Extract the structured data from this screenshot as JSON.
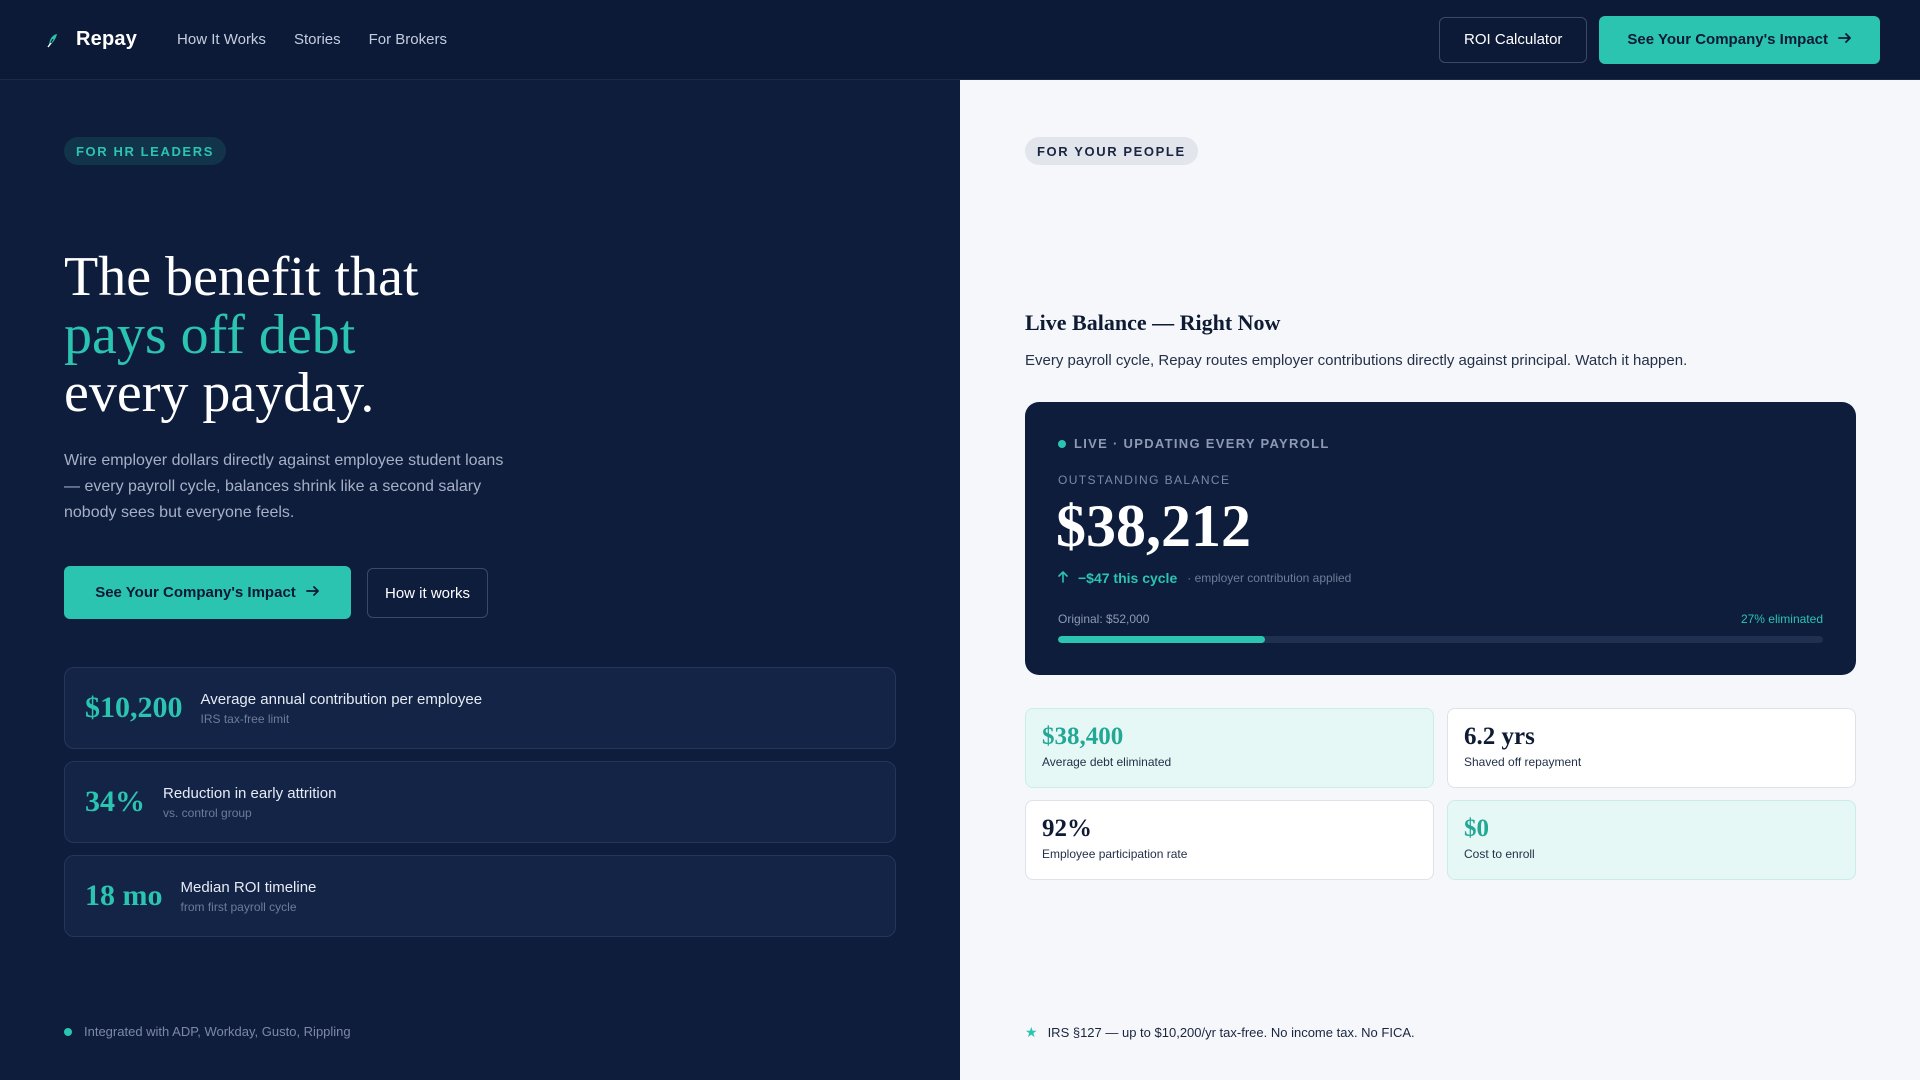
{
  "nav": {
    "brand": "Repay",
    "links": [
      "How It Works",
      "Stories",
      "For Brokers"
    ],
    "roi_button": "ROI Calculator",
    "cta_button": "See Your Company's Impact"
  },
  "left": {
    "pill": "FOR HR LEADERS",
    "title_line1": "The benefit that",
    "title_line2": "pays off debt",
    "title_line3": "every payday.",
    "description": "Wire employer dollars directly against employee student loans — every payroll cycle, balances shrink like a second salary nobody sees but everyone feels.",
    "cta_primary": "See Your Company's Impact",
    "cta_secondary": "How it works",
    "stats": [
      {
        "value": "$10,200",
        "label": "Average annual contribution per employee",
        "sub": "IRS tax-free limit"
      },
      {
        "value": "34%",
        "label": "Reduction in early attrition",
        "sub": "vs. control group"
      },
      {
        "value": "18 mo",
        "label": "Median ROI timeline",
        "sub": "from first payroll cycle"
      }
    ],
    "integrations": "Integrated with ADP, Workday, Gusto, Rippling"
  },
  "right": {
    "pill": "FOR YOUR PEOPLE",
    "live_title": "Live Balance — Right Now",
    "live_desc": "Every payroll cycle, Repay routes employer contributions directly against principal. Watch it happen.",
    "card": {
      "badge": "LIVE · UPDATING EVERY PAYROLL",
      "balance_label": "OUTSTANDING BALANCE",
      "balance": "$38,212",
      "delta": "−$47 this cycle",
      "delta_sub": "· employer contribution applied",
      "original": "Original: $52,000",
      "eliminated": "27% eliminated",
      "progress_fraction": 0.27
    },
    "mini_stats": [
      {
        "value": "$38,400",
        "label": "Average debt eliminated"
      },
      {
        "value": "6.2 yrs",
        "label": "Shaved off repayment"
      },
      {
        "value": "92%",
        "label": "Employee participation rate"
      },
      {
        "value": "$0",
        "label": "Cost to enroll"
      }
    ],
    "irs_note": "IRS §127 — up to $10,200/yr tax-free. No income tax. No FICA."
  },
  "colors": {
    "navy": "#0e1d3c",
    "teal": "#2bc4b0",
    "light_bg": "#f5f7fa"
  },
  "icons": {
    "brand": "leaf-icon",
    "arrow": "arrow-right-icon",
    "up": "arrow-up-icon",
    "star": "star-icon"
  }
}
